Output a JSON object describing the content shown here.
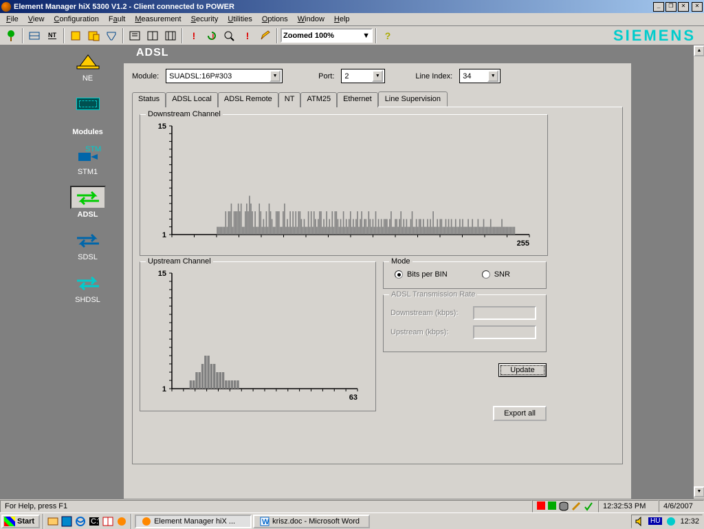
{
  "title": "Element Manager hiX 5300 V1.2 - Client connected to POWER",
  "menus": [
    "File",
    "View",
    "Configuration",
    "Fault",
    "Measurement",
    "Security",
    "Utilities",
    "Options",
    "Window",
    "Help"
  ],
  "zoom": "Zoomed 100%",
  "brand": "SIEMENS",
  "sidebar": {
    "ne": "NE",
    "modules_header": "Modules",
    "items": [
      {
        "label": "STM1"
      },
      {
        "label": "ADSL",
        "selected": true
      },
      {
        "label": "SDSL"
      },
      {
        "label": "SHDSL"
      }
    ]
  },
  "panel": {
    "title": "ADSL",
    "module_label": "Module:",
    "module_value": "SUADSL:16P#303",
    "port_label": "Port:",
    "port_value": "2",
    "line_index_label": "Line Index:",
    "line_index_value": "34",
    "tabs": [
      "Status",
      "ADSL Local",
      "ADSL Remote",
      "NT",
      "ATM25",
      "Ethernet",
      "Line Supervision"
    ],
    "active_tab": "Line Supervision",
    "downstream_legend": "Downstream Channel",
    "upstream_legend": "Upstream Channel",
    "mode_legend": "Mode",
    "mode_bits": "Bits per BIN",
    "mode_snr": "SNR",
    "rate_legend": "ADSL Transmission Rate",
    "rate_down": "Downstream (kbps):",
    "rate_up": "Upstream (kbps):",
    "update_btn": "Update",
    "export_btn": "Export all"
  },
  "status": {
    "help": "For Help, press F1",
    "time": "12:32:53 PM",
    "date": "4/6/2007"
  },
  "taskbar": {
    "start": "Start",
    "tasks": [
      {
        "label": "Element Manager hiX ...",
        "active": true
      },
      {
        "label": "krisz.doc - Microsoft Word",
        "active": false
      }
    ],
    "lang": "HU",
    "clock": "12:32"
  },
  "chart_data": [
    {
      "type": "bar",
      "title": "Downstream Channel",
      "xlabel": "",
      "ylabel": "",
      "xlim": [
        0,
        255
      ],
      "ylim": [
        1,
        15
      ],
      "x_start": 32,
      "values": [
        2,
        2,
        2,
        2,
        2,
        2,
        4,
        2,
        4,
        4,
        5,
        2,
        4,
        4,
        4,
        5,
        4,
        5,
        2,
        2,
        4,
        5,
        4,
        6,
        5,
        4,
        2,
        4,
        2,
        2,
        5,
        4,
        2,
        3,
        2,
        4,
        2,
        5,
        4,
        3,
        2,
        2,
        4,
        4,
        4,
        2,
        2,
        4,
        5,
        2,
        3,
        2,
        4,
        2,
        4,
        2,
        4,
        2,
        4,
        4,
        3,
        2,
        3,
        2,
        2,
        4,
        2,
        4,
        2,
        4,
        3,
        2,
        3,
        4,
        4,
        2,
        3,
        2,
        4,
        2,
        3,
        2,
        4,
        2,
        4,
        4,
        3,
        2,
        3,
        2,
        4,
        2,
        3,
        2,
        3,
        4,
        2,
        3,
        2,
        3,
        4,
        2,
        3,
        4,
        2,
        3,
        3,
        2,
        4,
        3,
        2,
        3,
        2,
        4,
        2,
        3,
        2,
        3,
        2,
        3,
        3,
        3,
        2,
        3,
        4,
        2,
        2,
        3,
        3,
        2,
        3,
        4,
        2,
        3,
        2,
        3,
        2,
        2,
        3,
        4,
        2,
        2,
        3,
        2,
        3,
        3,
        2,
        3,
        2,
        2,
        3,
        2,
        3,
        2,
        4,
        2,
        2,
        3,
        2,
        3,
        3,
        2,
        2,
        3,
        2,
        3,
        2,
        3,
        2,
        2,
        3,
        2,
        2,
        3,
        2,
        3,
        2,
        2,
        2,
        3,
        2,
        2,
        3,
        2,
        2,
        2,
        3,
        2,
        2,
        2,
        3,
        2,
        2,
        2,
        2,
        3,
        2,
        2,
        2,
        2,
        2,
        2,
        2,
        3,
        2,
        2,
        2,
        2,
        2,
        2,
        2,
        2,
        2
      ]
    },
    {
      "type": "bar",
      "title": "Upstream Channel",
      "xlabel": "",
      "ylabel": "",
      "xlim": [
        0,
        63
      ],
      "ylim": [
        1,
        15
      ],
      "x_start": 6,
      "values": [
        2,
        2,
        3,
        3,
        4,
        5,
        5,
        4,
        4,
        3,
        3,
        3,
        2,
        2,
        2,
        2,
        2
      ]
    }
  ]
}
